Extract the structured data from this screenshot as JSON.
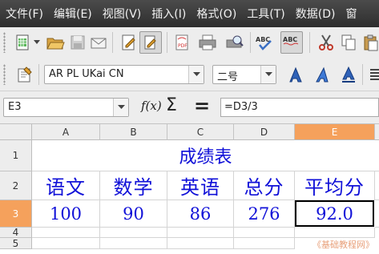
{
  "menu": [
    "文件(F)",
    "编辑(E)",
    "视图(V)",
    "插入(I)",
    "格式(O)",
    "工具(T)",
    "数据(D)",
    "窗"
  ],
  "toolbar": {
    "font_name": "AR PL UKai CN",
    "font_size": "二号",
    "spell_icon_text": "ABC"
  },
  "formula_bar": {
    "name_box": "E3",
    "fx_label": "f(x)",
    "sigma_label": "Σ",
    "equals_label": "=",
    "formula": "=D3/3"
  },
  "grid": {
    "columns": [
      "A",
      "B",
      "C",
      "D",
      "E"
    ],
    "selected_column": "E",
    "rows": [
      "1",
      "2",
      "3",
      "4",
      "5"
    ],
    "selected_row": "3",
    "title": "成绩表",
    "headers": [
      "语文",
      "数学",
      "英语",
      "总分",
      "平均分"
    ],
    "values": [
      "100",
      "90",
      "86",
      "276",
      "92.0"
    ],
    "active_cell": "E3",
    "text_color": "#1010d8",
    "selection_color": "#f5a15c"
  },
  "watermark": "《基础教程网》"
}
